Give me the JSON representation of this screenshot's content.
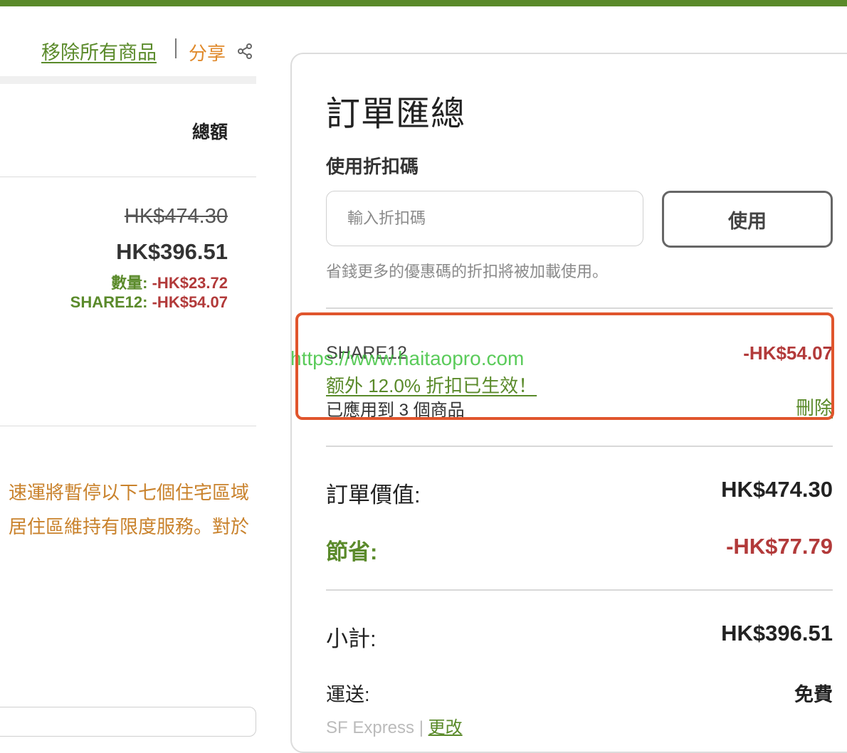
{
  "cart": {
    "remove_all": "移除所有商品",
    "share": "分享",
    "column_total": "總額",
    "item": {
      "original_price": "HK$474.30",
      "final_price": "HK$396.51",
      "discounts": [
        {
          "label": "數量:",
          "amount": "-HK$23.72"
        },
        {
          "label": "SHARE12:",
          "amount": "-HK$54.07"
        }
      ]
    },
    "notice_lines": [
      "速運將暫停以下七個住宅區域",
      "居住區維持有限度服務。對於"
    ]
  },
  "summary": {
    "title": "訂單匯總",
    "coupon_label": "使用折扣碼",
    "coupon_placeholder": "輸入折扣碼",
    "apply_button": "使用",
    "hint": "省錢更多的優惠碼的折扣將被加載使用。",
    "applied_coupon": {
      "code": "SHARE12",
      "amount": "-HK$54.07",
      "message": "额外 12.0% 折扣已生效！",
      "applied_to": "已應用到 3 個商品",
      "remove": "刪除"
    },
    "watermark": "https://www.haitaopro.com",
    "order_value_label": "訂單價值:",
    "order_value": "HK$474.30",
    "savings_label": "節省:",
    "savings": "-HK$77.79",
    "subtotal_label": "小計:",
    "subtotal": "HK$396.51",
    "shipping_label": "運送:",
    "shipping_value": "免費",
    "shipping_method": "SF Express",
    "shipping_change": "更改"
  },
  "colors": {
    "brand_green": "#5a8a2a",
    "discount_red": "#b23a3a",
    "accent_orange": "#e08a2c",
    "highlight_box": "#e0552d"
  }
}
